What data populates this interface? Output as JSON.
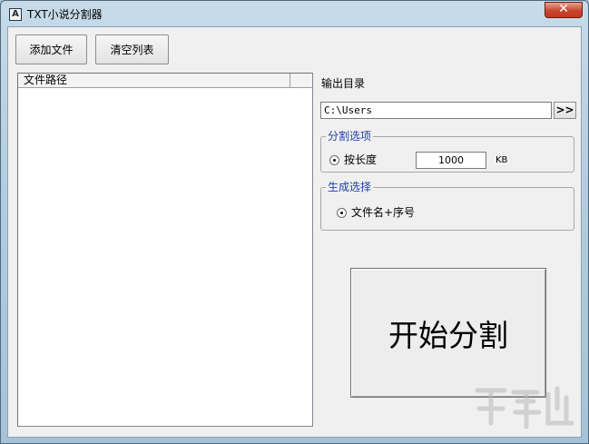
{
  "window": {
    "title": "TXT小说分割器",
    "app_icon_glyph": "A",
    "close_glyph": "✕"
  },
  "toolbar": {
    "add_file_label": "添加文件",
    "clear_list_label": "清空列表"
  },
  "file_list": {
    "columns": [
      "文件路径"
    ],
    "rows": []
  },
  "output": {
    "label": "输出目录",
    "path": "C:\\Users",
    "browse_label": ">>"
  },
  "split_options": {
    "legend": "分割选项",
    "by_length_label": "按长度",
    "length_value": "1000",
    "unit": "KB"
  },
  "generate_options": {
    "legend": "生成选择",
    "filename_option_label": "文件名+序号"
  },
  "start_button": {
    "label": "开始分割"
  },
  "colors": {
    "legend_text": "#1f3fa8",
    "close_button": "#c9452d"
  }
}
